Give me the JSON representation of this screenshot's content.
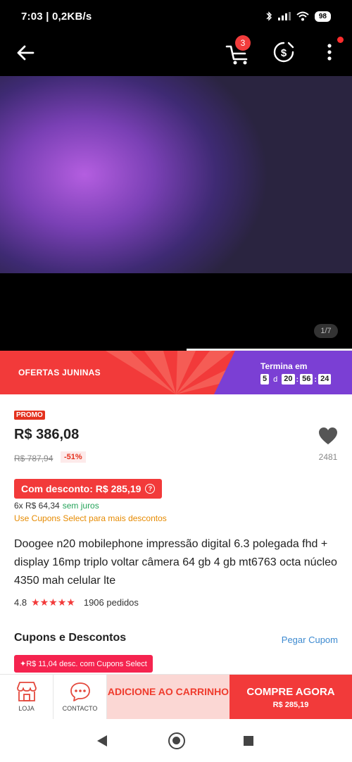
{
  "status_bar": {
    "time": "7:03",
    "speed": "0,2KB/s",
    "battery": "98"
  },
  "nav": {
    "cart_count": "3"
  },
  "gallery": {
    "counter": "1/7"
  },
  "promo": {
    "title": "OFERTAS JUNINAS",
    "ends_label": "Termina em",
    "countdown": {
      "days": "5",
      "days_unit": "d",
      "hours": "20",
      "minutes": "56",
      "seconds": "24"
    }
  },
  "product": {
    "promo_tag": "PROMO",
    "price": "R$ 386,08",
    "old_price": "R$ 787,94",
    "discount": "-51%",
    "wishlist_count": "2481",
    "coupon_price": "Com desconto: R$ 285,19",
    "installments": "6x R$ 64,34",
    "installments_note": "sem juros",
    "use_coupons": "Use Cupons Select para mais descontos",
    "title": "Doogee n20 mobilephone impressão digital 6.3 polegada fhd + display 16mp triplo voltar câmera 64 gb 4 gb mt6763 octa núcleo 4350 mah celular lte",
    "rating": "4.8",
    "stars": "★★★★★",
    "orders": "1906 pedidos"
  },
  "coupons": {
    "heading": "Cupons e Descontos",
    "get_coupon": "Pegar Cupom",
    "chip": "✦R$ 11,04 desc. com Cupons Select"
  },
  "action_bar": {
    "store_label": "LOJA",
    "contact_label": "CONTACTO",
    "add_to_cart": "ADICIONE AO CARRINHO",
    "buy_now": "COMPRE AGORA",
    "buy_price": "R$ 285,19"
  },
  "colors": {
    "accent": "#f23a3a",
    "purple": "#7b3fd4",
    "link": "#3d8ad0",
    "orange": "#e68a00",
    "green": "#24a35a"
  }
}
